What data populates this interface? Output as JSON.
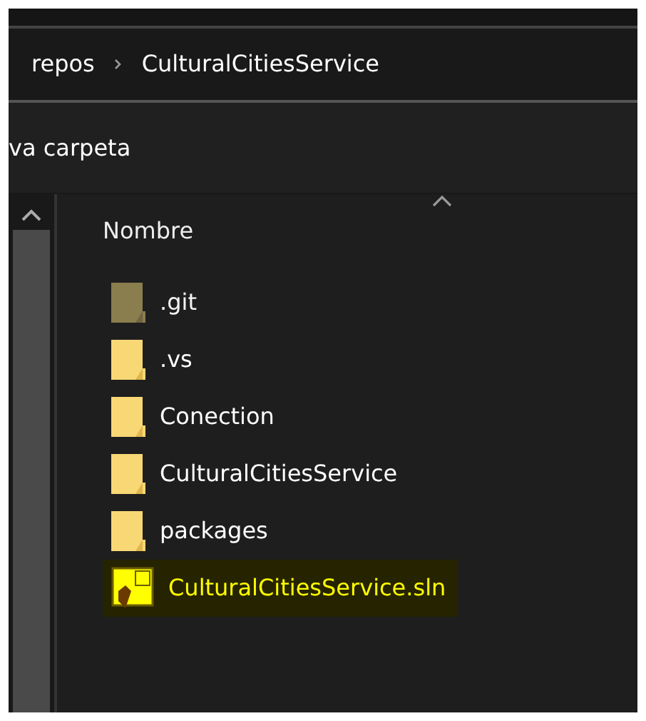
{
  "breadcrumb": [
    {
      "label": "repos"
    },
    {
      "label": "CulturalCitiesService"
    }
  ],
  "toolbar": {
    "new_folder_label": "va carpeta"
  },
  "file_list": {
    "column_header": "Nombre",
    "sort_ascending": true,
    "items": [
      {
        "name": ".git",
        "kind": "folder",
        "hidden": true,
        "selected": false
      },
      {
        "name": ".vs",
        "kind": "folder",
        "hidden": false,
        "selected": false
      },
      {
        "name": "Conection",
        "kind": "folder",
        "hidden": false,
        "selected": false
      },
      {
        "name": "CulturalCitiesService",
        "kind": "folder",
        "hidden": false,
        "selected": false
      },
      {
        "name": "packages",
        "kind": "folder",
        "hidden": false,
        "selected": false
      },
      {
        "name": "CulturalCitiesService.sln",
        "kind": "solution",
        "hidden": false,
        "selected": true
      }
    ]
  }
}
